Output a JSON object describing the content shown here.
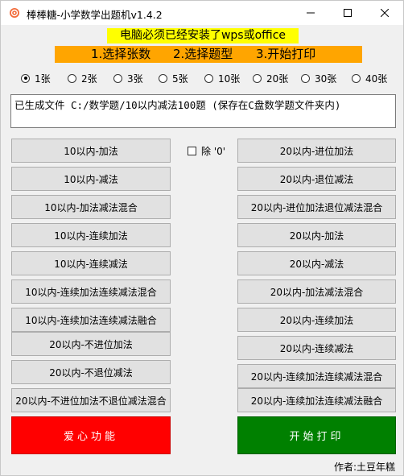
{
  "window": {
    "title": "棒棒糖-小学数学出题机v1.4.2"
  },
  "banner": {
    "notice": "电脑必须已经安装了wps或office",
    "steps": [
      "1.选择张数",
      "2.选择题型",
      "3.开始打印"
    ]
  },
  "sheets": {
    "options": [
      "1张",
      "2张",
      "3张",
      "5张",
      "10张",
      "20张",
      "30张",
      "40张"
    ],
    "selected": "1张"
  },
  "output": {
    "text": "已生成文件 C:/数学题/10以内减法100题 (保存在C盘数学题文件夹内)"
  },
  "options": {
    "exclude_zero_label": "除 '0'",
    "exclude_zero_checked": false
  },
  "left_buttons": [
    "10以内-加法",
    "10以内-减法",
    "10以内-加法减法混合",
    "10以内-连续加法",
    "10以内-连续减法",
    "10以内-连续加法连续减法混合",
    "10以内-连续加法连续减法融合",
    "20以内-不进位加法",
    "20以内-不退位减法",
    "20以内-不进位加法不退位减法混合"
  ],
  "right_buttons": [
    "20以内-进位加法",
    "20以内-退位减法",
    "20以内-进位加法退位减法混合",
    "20以内-加法",
    "20以内-减法",
    "20以内-加法减法混合",
    "20以内-连续加法",
    "20以内-连续减法",
    "20以内-连续加法连续减法混合",
    "20以内-连续加法连续减法融合"
  ],
  "actions": {
    "love": "爱心功能",
    "start": "开始打印"
  },
  "footer": {
    "author": "作者:土豆年糕"
  },
  "colors": {
    "notice_bg": "#ffff00",
    "steps_bg": "#ffa500",
    "love_bg": "#ff0000",
    "start_bg": "#008000"
  }
}
